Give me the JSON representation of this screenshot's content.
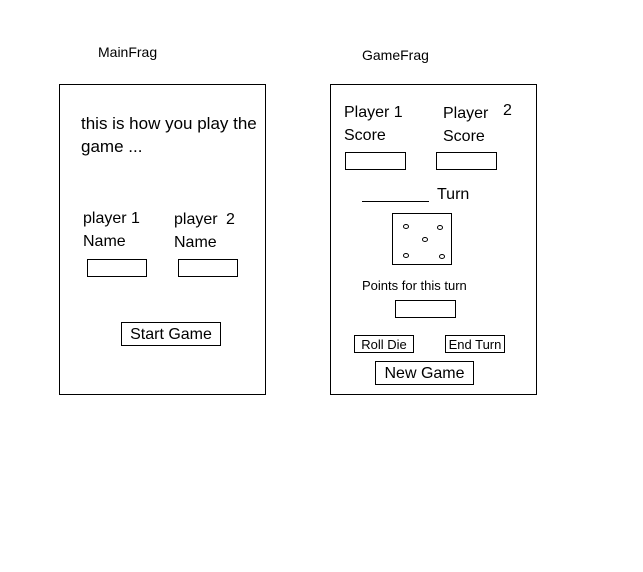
{
  "main_frag": {
    "title": "MainFrag",
    "instructions_line1": "this is how you play the",
    "instructions_line2": "game ...",
    "player1_label_line1": "player 1",
    "player1_label_line2": "Name",
    "player2_label_line1": "player",
    "player2_label_num": "2",
    "player2_label_line2": "Name",
    "start_button": "Start Game"
  },
  "game_frag": {
    "title": "GameFrag",
    "player1_label_line1": "Player 1",
    "player1_label_line2": "Score",
    "player2_label_line1": "Player",
    "player2_label_num": "2",
    "player2_label_line2": "Score",
    "turn_label": "Turn",
    "points_label": "Points for this turn",
    "roll_button": "Roll Die",
    "end_button": "End Turn",
    "new_game_button": "New Game"
  }
}
